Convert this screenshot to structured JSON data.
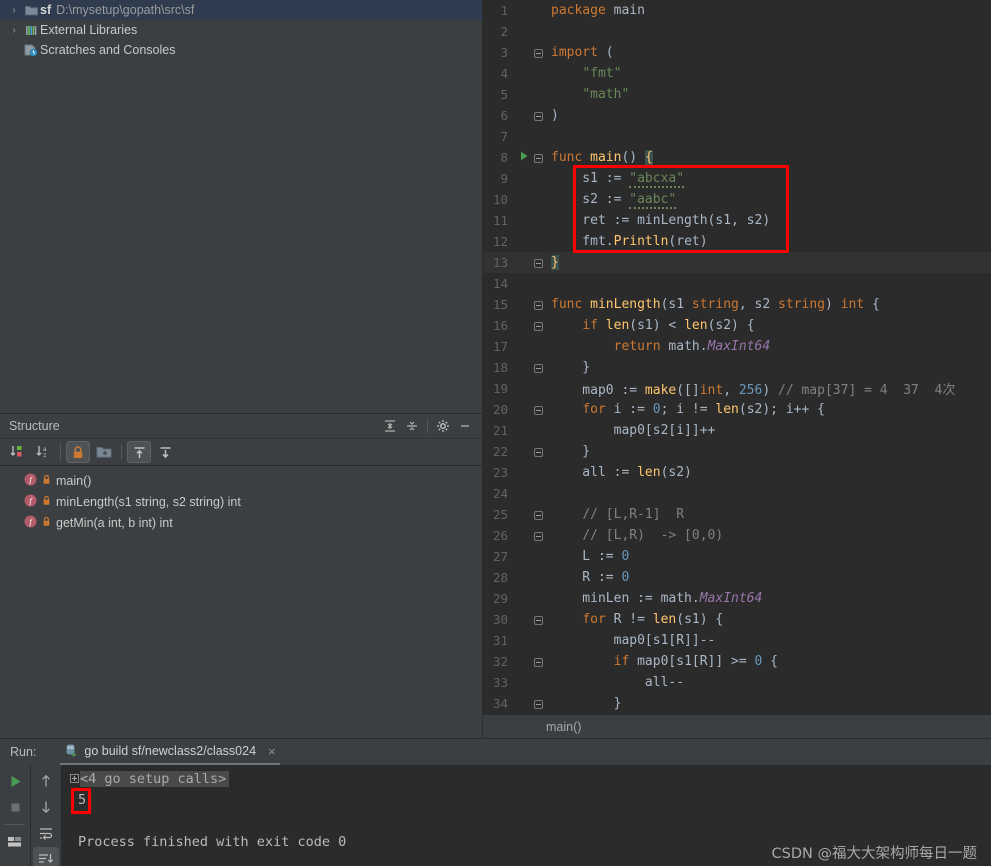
{
  "project_tree": {
    "rows": [
      {
        "arrow": "›",
        "icon": "folder-icon",
        "name": "sf",
        "path": "D:\\mysetup\\gopath\\src\\sf",
        "selected": true
      },
      {
        "arrow": "›",
        "icon": "library-icon",
        "name": "External Libraries",
        "path": "",
        "selected": false
      },
      {
        "arrow": "",
        "icon": "scratches-icon",
        "name": "Scratches and Consoles",
        "path": "",
        "selected": false
      }
    ]
  },
  "structure": {
    "title": "Structure",
    "header_buttons": [
      "expand-all-icon",
      "collapse-all-icon",
      "gear-icon",
      "minimize-icon"
    ],
    "toolbar_buttons": [
      "sort-by-visibility-icon",
      "sort-alphabetically-icon",
      "show-non-public-icon",
      "show-anonymous-classes-icon",
      "show-inherited-icon",
      "show-fields-icon"
    ],
    "items": [
      {
        "kind": "f",
        "lock": "lock-icon",
        "label": "main()"
      },
      {
        "kind": "f",
        "lock": "lock-icon",
        "label": "minLength(s1 string, s2 string) int"
      },
      {
        "kind": "f",
        "lock": "lock-icon",
        "label": "getMin(a int, b int) int"
      }
    ]
  },
  "editor": {
    "breadcrumb": "main()",
    "current_line": 13,
    "run_marker_line": 8,
    "lines": [
      {
        "n": 1,
        "fold": "",
        "html": "<span class=\"kw\">package</span> <span class=\"pkg\">main</span>"
      },
      {
        "n": 2,
        "fold": "",
        "html": ""
      },
      {
        "n": 3,
        "fold": "start",
        "html": "<span class=\"kw\">import</span> ("
      },
      {
        "n": 4,
        "fold": "bar",
        "html": "    <span class=\"str\">\"fmt\"</span>"
      },
      {
        "n": 5,
        "fold": "bar",
        "html": "    <span class=\"str\">\"math\"</span>"
      },
      {
        "n": 6,
        "fold": "end",
        "html": ")"
      },
      {
        "n": 7,
        "fold": "",
        "html": ""
      },
      {
        "n": 8,
        "fold": "start",
        "html": "<span class=\"kw\">func</span> <span class=\"fn\">main</span>() <span class=\"brace-hl\">{</span>"
      },
      {
        "n": 9,
        "fold": "bar",
        "html": "    s1 := <span class=\"str\"><span class=\"typo\">\"abcxa\"</span></span>"
      },
      {
        "n": 10,
        "fold": "bar",
        "html": "    s2 := <span class=\"str\"><span class=\"typo\">\"aabc\"</span></span>"
      },
      {
        "n": 11,
        "fold": "bar",
        "html": "    ret := <span class=\"pkg\">minLength</span>(s1, s2)"
      },
      {
        "n": 12,
        "fold": "bar",
        "html": "    fmt.<span class=\"fn\">Println</span>(ret)"
      },
      {
        "n": 13,
        "fold": "end",
        "html": "<span class=\"brace-hl\">}</span>"
      },
      {
        "n": 14,
        "fold": "",
        "html": ""
      },
      {
        "n": 15,
        "fold": "start",
        "html": "<span class=\"kw\">func</span> <span class=\"fn\">minLength</span>(s1 <span class=\"kw\">string</span>, s2 <span class=\"kw\">string</span>) <span class=\"kw\">int</span> {"
      },
      {
        "n": 16,
        "fold": "start2",
        "html": "    <span class=\"kw\">if</span> <span class=\"fn\">len</span>(s1) &lt; <span class=\"fn\">len</span>(s2) {"
      },
      {
        "n": 17,
        "fold": "bar2",
        "html": "        <span class=\"kw\">return</span> math.<span class=\"italicid\">MaxInt64</span>"
      },
      {
        "n": 18,
        "fold": "end2",
        "html": "    }"
      },
      {
        "n": 19,
        "fold": "bar",
        "html": "    map0 := <span class=\"fn\">make</span>([]<span class=\"kw\">int</span>, <span class=\"num\">256</span>) <span class=\"com\">// map[37] = 4  37  4次</span>"
      },
      {
        "n": 20,
        "fold": "start2",
        "html": "    <span class=\"kw\">for</span> i := <span class=\"num\">0</span>; i != <span class=\"fn\">len</span>(s2); i++ {"
      },
      {
        "n": 21,
        "fold": "bar2",
        "html": "        map0[s2[i]]++"
      },
      {
        "n": 22,
        "fold": "end2",
        "html": "    }"
      },
      {
        "n": 23,
        "fold": "bar",
        "html": "    all := <span class=\"fn\">len</span>(s2)"
      },
      {
        "n": 24,
        "fold": "bar",
        "html": ""
      },
      {
        "n": 25,
        "fold": "start2",
        "html": "    <span class=\"com\">// [L,R-1]  R</span>"
      },
      {
        "n": 26,
        "fold": "end2",
        "html": "    <span class=\"com\">// [L,R)  -&gt; [0,0)</span>"
      },
      {
        "n": 27,
        "fold": "bar",
        "html": "    L := <span class=\"num\">0</span>"
      },
      {
        "n": 28,
        "fold": "bar",
        "html": "    R := <span class=\"num\">0</span>"
      },
      {
        "n": 29,
        "fold": "bar",
        "html": "    minLen := math.<span class=\"italicid\">MaxInt64</span>"
      },
      {
        "n": 30,
        "fold": "start2",
        "html": "    <span class=\"kw\">for</span> R != <span class=\"fn\">len</span>(s1) {"
      },
      {
        "n": 31,
        "fold": "bar2",
        "html": "        map0[s1[R]]--"
      },
      {
        "n": 32,
        "fold": "start3",
        "html": "        <span class=\"kw\">if</span> map0[s1[R]] &gt;= <span class=\"num\">0</span> {"
      },
      {
        "n": 33,
        "fold": "bar3",
        "html": "            all--"
      },
      {
        "n": 34,
        "fold": "end3",
        "html": "        }"
      }
    ]
  },
  "run_panel": {
    "run_label": "Run:",
    "tab_title": "go build sf/newclass2/class024",
    "tab_close": "×",
    "tab_icon": "go-run-config-icon",
    "left_buttons": [
      "run-icon",
      "stop-icon",
      "show-tree-icon"
    ],
    "right_buttons": [
      "up-arrow-icon",
      "down-arrow-icon",
      "soft-wrap-icon",
      "scroll-to-end-icon"
    ],
    "console": {
      "folded_label": "<4 go setup calls>",
      "output": "5",
      "finish_message": "Process finished with exit code 0"
    }
  },
  "watermark": "CSDN @福大大架构师每日一题",
  "colors": {
    "editor_bg": "#2b2b2b",
    "panel_bg": "#3c3f41",
    "annotation_red": "#ff0000",
    "selection_blue": "#2f3c4f",
    "keyword_orange": "#cc7832",
    "string_green": "#6a8759",
    "number_blue": "#6897bb",
    "function_yellow": "#ffc66d",
    "comment_gray": "#808080",
    "run_green": "#499c54"
  }
}
